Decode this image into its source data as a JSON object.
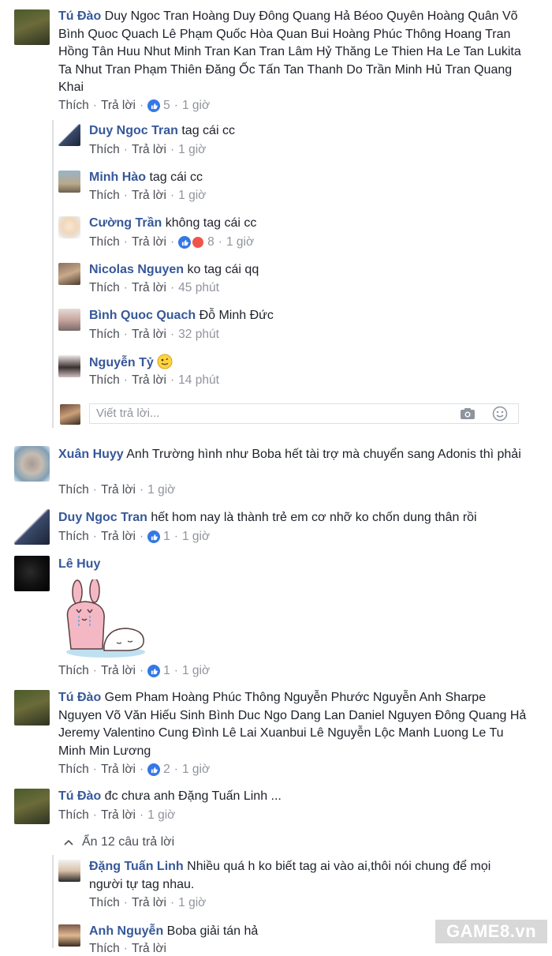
{
  "actions": {
    "like": "Thích",
    "reply": "Trả lời"
  },
  "comments": [
    {
      "author": "Tú Đào",
      "text": "Duy Ngoc Tran Hoàng Duy Đông Quang Hả Béoo Quyên Hoàng Quân Võ Bình Quoc Quach Lê Phạm Quốc Hòa Quan Bui Hoàng Phúc Thông Hoang Tran Hồng Tân Huu Nhut Minh Tran Kan Tran Lâm Hỷ Thăng Le Thien Ha Le Tan Lukita Ta Nhut Tran Phạm Thiên Đăng Ốc Tấn Tan Thanh Do Trần Minh Hủ Tran Quang Khai",
      "reactions": "5",
      "time": "1 giờ"
    },
    {
      "author": "Duy Ngoc Tran",
      "text": "tag cái cc",
      "time": "1 giờ"
    },
    {
      "author": "Minh Hào",
      "text": "tag cái cc",
      "time": "1 giờ"
    },
    {
      "author": "Cường Trần",
      "text": "không tag cái cc",
      "reactions": "8",
      "time": "1 giờ"
    },
    {
      "author": "Nicolas Nguyen",
      "text": "ko tag cái qq",
      "time": "45 phút"
    },
    {
      "author": "Bình Quoc Quach",
      "text": "Đỗ Minh Đức",
      "time": "32 phút"
    },
    {
      "author": "Nguyễn Tỷ",
      "text": "",
      "time": "14 phút"
    },
    {
      "author": "Xuân Huyy",
      "text": "Anh Trường hình như Boba hết tài trợ mà chuyển sang Adonis thì phải",
      "time": "1 giờ"
    },
    {
      "author": "Duy Ngoc Tran",
      "text": "hết hom nay là thành trẻ em cơ nhỡ ko chốn dung thân rồi",
      "reactions": "1",
      "time": "1 giờ"
    },
    {
      "author": "Lê Huy",
      "text": "",
      "reactions": "1",
      "time": "1 giờ"
    },
    {
      "author": "Tú Đào",
      "text": "Gem Pham Hoàng Phúc Thông Nguyễn Phước Nguyễn Anh Sharpe Nguyen Võ Văn Hiếu Sinh Bình Duc Ngo Dang Lan Daniel Nguyen Đông Quang Hả Jeremy Valentino Cung Đình Lê Lai Xuanbui Lê Nguyễn Lộc Manh Luong Le Tu Minh Min Lương",
      "reactions": "2",
      "time": "1 giờ"
    },
    {
      "author": "Tú Đào",
      "text": "đc chưa anh Đặng Tuấn Linh ...",
      "time": "1 giờ"
    },
    {
      "author": "Đặng Tuấn Linh",
      "text": "Nhiều quá h ko biết tag ai vào ai,thôi nói chung để mọi người tự tag nhau.",
      "time": "1 giờ"
    },
    {
      "author": "Anh Nguyễn",
      "text": "Boba giải tán hả",
      "time": ""
    }
  ],
  "reply_box": {
    "placeholder": "Viết trả lời..."
  },
  "hide_replies": "Ẩn 12 câu trả lời",
  "watermark": "GAME8.vn",
  "colors": {
    "name": "#365899",
    "meta": "#90949c",
    "like_blue": "#3578e5",
    "angry": "#f0554a"
  }
}
